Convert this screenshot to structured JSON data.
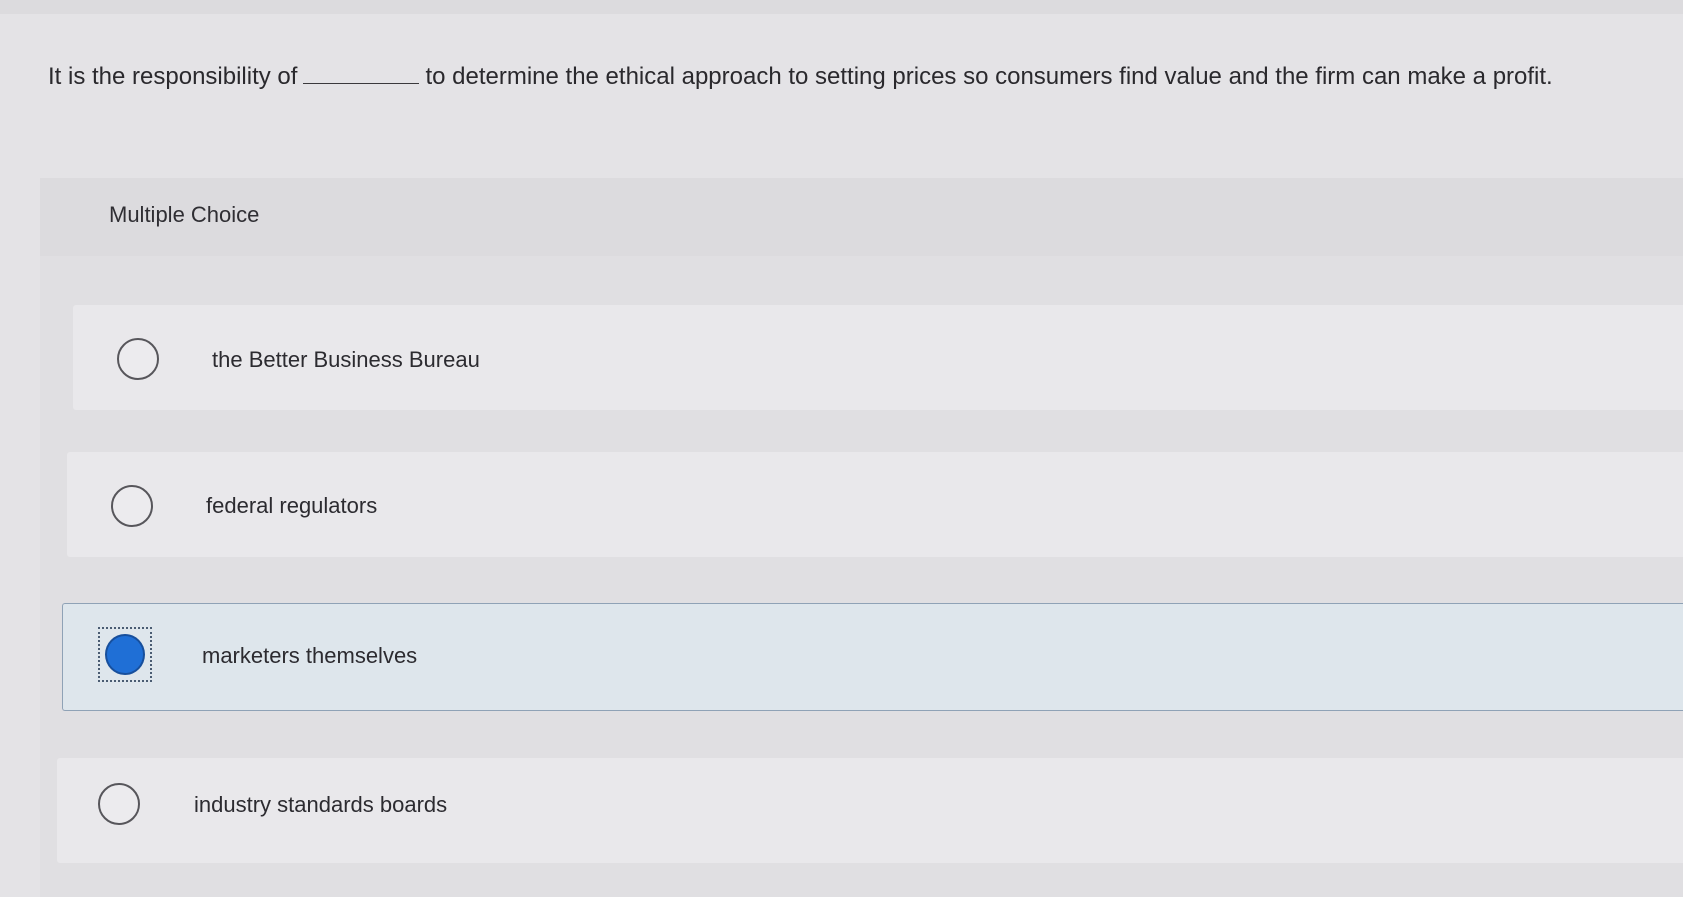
{
  "question": {
    "text_before": "It is the responsibility of",
    "text_after": "to determine the ethical approach to setting prices so consumers find value and the firm can make a profit."
  },
  "question_type": {
    "label": "Multiple Choice"
  },
  "options": [
    {
      "label": "the Better Business Bureau",
      "selected": false
    },
    {
      "label": "federal regulators",
      "selected": false
    },
    {
      "label": "marketers themselves",
      "selected": true
    },
    {
      "label": "industry standards boards",
      "selected": false
    }
  ],
  "colors": {
    "selected_radio": "#1f6fd6",
    "selected_option_bg": "#dee6ec"
  }
}
